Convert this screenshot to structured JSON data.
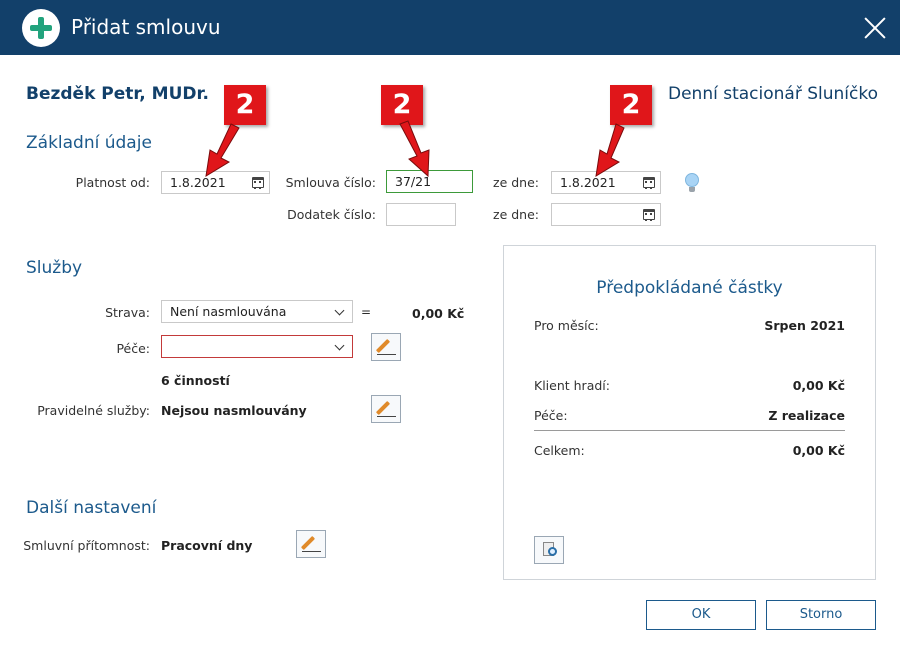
{
  "window": {
    "title": "Přidat smlouvu"
  },
  "header": {
    "client_name": "Bezděk Petr, MUDr.",
    "facility": "Denní stacionář Sluníčko"
  },
  "basic": {
    "section_title": "Základní údaje",
    "valid_from_label": "Platnost od:",
    "valid_from_value": "1.8.2021",
    "contract_no_label": "Smlouva číslo:",
    "contract_no_value": "37/21",
    "date_label": "ze dne:",
    "contract_date_value": "1.8.2021",
    "amendment_label": "Dodatek číslo:",
    "amendment_value": "",
    "amendment_date_value": ""
  },
  "services": {
    "section_title": "Služby",
    "meal_label": "Strava:",
    "meal_value": "Není nasmlouvána",
    "equals": "=",
    "meal_price": "0,00 Kč",
    "care_label": "Péče:",
    "care_value": "",
    "care_activities": "6 činností",
    "regular_label": "Pravidelné služby:",
    "regular_value": "Nejsou nasmlouvány"
  },
  "other": {
    "section_title": "Další nastavení",
    "presence_label": "Smluvní přítomnost:",
    "presence_value": "Pracovní dny"
  },
  "estimate": {
    "title": "Předpokládané částky",
    "month_label": "Pro měsíc:",
    "month_value": "Srpen 2021",
    "client_pays_label": "Klient hradí:",
    "client_pays_value": "0,00 Kč",
    "care_label": "Péče:",
    "care_value": "Z realizace",
    "total_label": "Celkem:",
    "total_value": "0,00 Kč"
  },
  "buttons": {
    "ok": "OK",
    "cancel": "Storno"
  },
  "annotations": {
    "marker_label": "2",
    "marker_color": "#e0161a"
  },
  "colors": {
    "titlebar": "#12406a",
    "accent": "#1c5a8c",
    "plus_icon": "#22a37d"
  },
  "icons": [
    "plus-icon",
    "close-icon",
    "calendar-icon",
    "chevron-down-icon",
    "pencil-icon",
    "lightbulb-icon",
    "preview-icon"
  ]
}
